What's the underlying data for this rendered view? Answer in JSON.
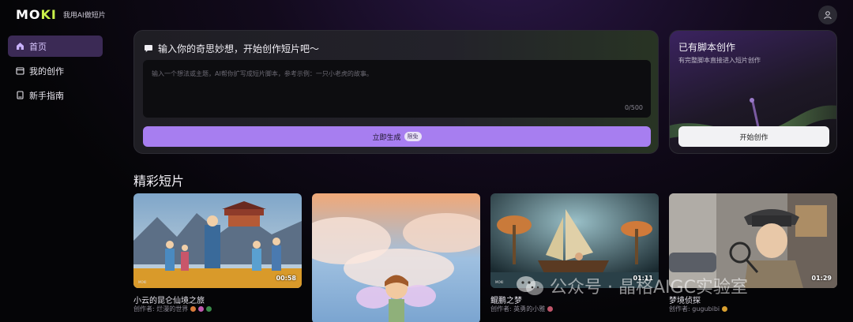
{
  "brand": {
    "logo_text_1": "MO",
    "logo_text_2": "KI",
    "tagline": "我用AI做短片"
  },
  "sidebar": {
    "items": [
      {
        "label": "首页",
        "icon": "home-icon",
        "active": true
      },
      {
        "label": "我的创作",
        "icon": "folder-icon",
        "active": false
      },
      {
        "label": "新手指南",
        "icon": "book-icon",
        "active": false
      }
    ]
  },
  "create": {
    "title": "输入你的奇思妙想，开始创作短片吧～",
    "placeholder": "输入一个想法或主题，AI帮你扩写成短片脚本，参考示例：一只小老虎的故事。",
    "counter": "0/500",
    "button_label": "立即生成",
    "badge": "限免"
  },
  "script": {
    "title": "已有脚本创作",
    "subtitle": "有完整脚本直接进入短片创作",
    "button_label": "开始创作"
  },
  "section_title": "精彩短片",
  "videos": [
    {
      "title": "小云的昆仑仙境之旅",
      "author": "创作者: 烂漫的世界",
      "duration": "00:58",
      "watermark": "MOKI"
    },
    {
      "title": "",
      "author": "",
      "duration": "",
      "watermark": ""
    },
    {
      "title": "鲲鹏之梦",
      "author": "创作者: 英勇的小雅",
      "duration": "01:11",
      "watermark": "MOKI"
    },
    {
      "title": "梦境侦探",
      "author": "创作者: gugubibi",
      "duration": "01:29",
      "watermark": ""
    }
  ],
  "watermark": "公众号 · 晶格AIGC实验室",
  "colors": {
    "accent": "#a77ef0",
    "active_nav": "#3b2a55",
    "logo_accent": "#c9f04a"
  }
}
